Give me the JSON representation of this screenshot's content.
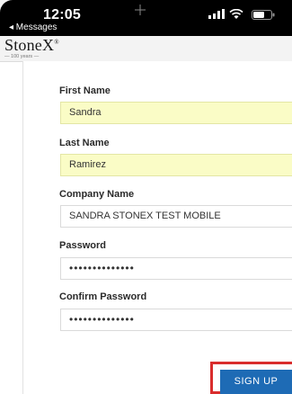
{
  "status_bar": {
    "time": "12:05",
    "back_app": "◂ Messages",
    "signal_icon": "cellular-signal-icon",
    "wifi_icon": "wifi-icon",
    "battery_icon": "battery-icon"
  },
  "header": {
    "logo": "StoneX",
    "logo_mark": "®",
    "tagline": "— 100 years —"
  },
  "form": {
    "first_name_label": "First Name",
    "first_name_value": "Sandra",
    "last_name_label": "Last Name",
    "last_name_value": "Ramirez",
    "company_label": "Company Name",
    "company_value": "SANDRA STONEX TEST MOBILE",
    "password_label": "Password",
    "password_value": "••••••••••••••",
    "confirm_password_label": "Confirm Password",
    "confirm_password_value": "••••••••••••••"
  },
  "actions": {
    "signup_label": "SIGN UP"
  },
  "colors": {
    "autofill_bg": "#fafcc6",
    "button_bg": "#1e6bb5",
    "highlight_outline": "#d92d2d"
  }
}
